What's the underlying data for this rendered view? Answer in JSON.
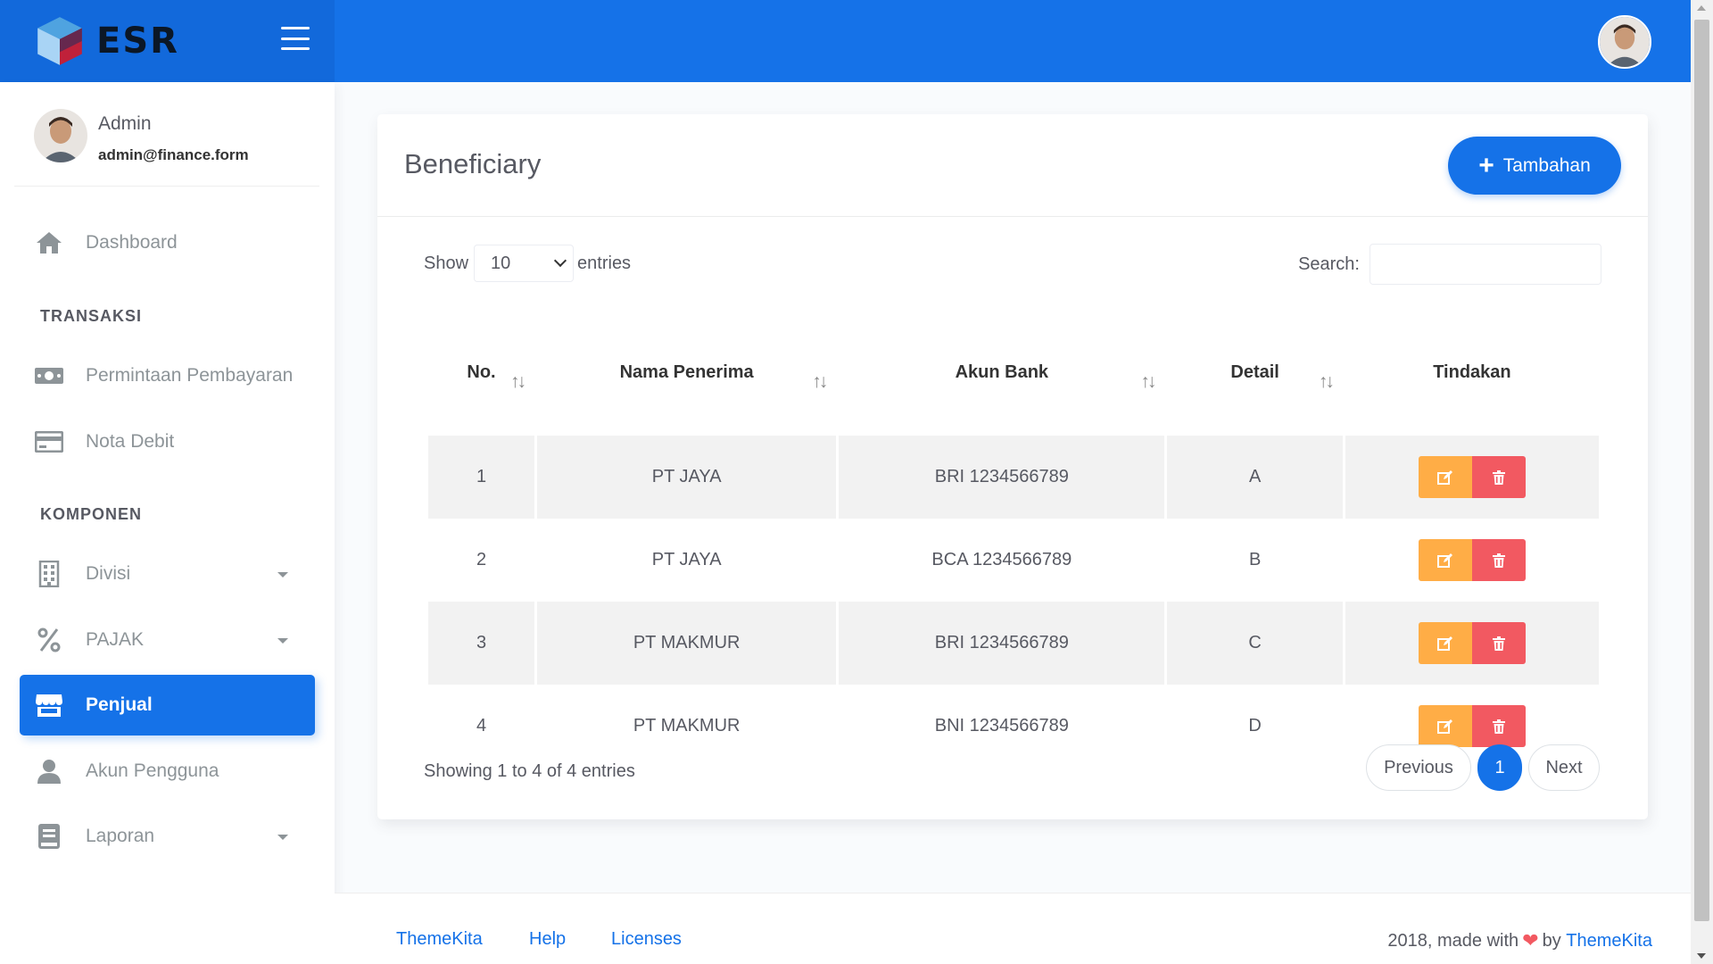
{
  "brand": {
    "name": "ESR"
  },
  "user": {
    "name": "Admin",
    "email": "admin@finance.form"
  },
  "sidebar": {
    "items": [
      {
        "label": "Dashboard",
        "icon": "home-icon"
      },
      {
        "section": "TRANSAKSI"
      },
      {
        "label": "Permintaan Pembayaran",
        "icon": "money-icon"
      },
      {
        "label": "Nota Debit",
        "icon": "credit-card-icon"
      },
      {
        "section": "KOMPONEN"
      },
      {
        "label": "Divisi",
        "icon": "building-icon"
      },
      {
        "label": "PAJAK",
        "icon": "percent-icon"
      },
      {
        "label": "Penjual",
        "icon": "store-icon",
        "active": true
      },
      {
        "label": "Akun Pengguna",
        "icon": "user-icon"
      },
      {
        "label": "Laporan",
        "icon": "book-icon"
      }
    ]
  },
  "card": {
    "title": "Beneficiary",
    "add_label": "Tambahan"
  },
  "table_controls": {
    "show_label": "Show",
    "entries_value": "10",
    "entries_label": "entries",
    "search_label": "Search:",
    "search_value": ""
  },
  "table": {
    "headers": [
      "No.",
      "Nama Penerima",
      "Akun Bank",
      "Detail",
      "Tindakan"
    ],
    "rows": [
      {
        "no": "1",
        "nama": "PT JAYA",
        "akun": "BRI 1234566789",
        "detail": "A"
      },
      {
        "no": "2",
        "nama": "PT JAYA",
        "akun": "BCA 1234566789",
        "detail": "B"
      },
      {
        "no": "3",
        "nama": "PT MAKMUR",
        "akun": "BRI 1234566789",
        "detail": "C"
      },
      {
        "no": "4",
        "nama": "PT MAKMUR",
        "akun": "BNI 1234566789",
        "detail": "D"
      }
    ]
  },
  "info": "Showing 1 to 4 of 4 entries",
  "pagination": {
    "previous": "Previous",
    "current": "1",
    "next": "Next"
  },
  "footer": {
    "links": [
      "ThemeKita",
      "Help",
      "Licenses"
    ],
    "copy_prefix": "2018, made with",
    "copy_by": "by",
    "copy_link": "ThemeKita"
  },
  "colors": {
    "primary": "#1572e8",
    "warning": "#ffad46",
    "danger": "#f25961"
  }
}
